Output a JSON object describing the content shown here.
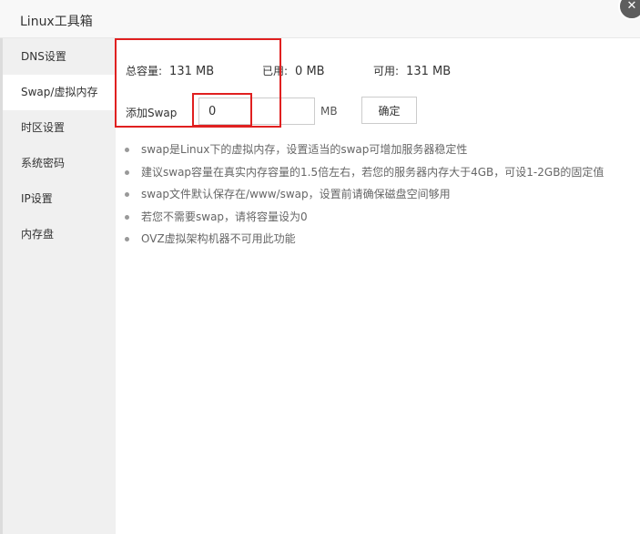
{
  "window": {
    "title": "Linux工具箱",
    "close_icon": "close-icon"
  },
  "sidebar": {
    "items": [
      {
        "label": "DNS设置",
        "active": false
      },
      {
        "label": "Swap/虚拟内存",
        "active": true
      },
      {
        "label": "时区设置",
        "active": false
      },
      {
        "label": "系统密码",
        "active": false
      },
      {
        "label": "IP设置",
        "active": false
      },
      {
        "label": "内存盘",
        "active": false
      }
    ]
  },
  "swap": {
    "total_label": "总容量:",
    "total_value": "131 MB",
    "used_label": "已用:",
    "used_value": "0 MB",
    "free_label": "可用:",
    "free_value": "131 MB",
    "add_label": "添加Swap",
    "input_value": "0",
    "unit": "MB",
    "confirm_label": "确定"
  },
  "notes": [
    "swap是Linux下的虚拟内存，设置适当的swap可增加服务器稳定性",
    "建议swap容量在真实内存容量的1.5倍左右，若您的服务器内存大于4GB，可设1-2GB的固定值",
    "swap文件默认保存在/www/swap，设置前请确保磁盘空间够用",
    "若您不需要swap，请将容量设为0",
    "OVZ虚拟架构机器不可用此功能"
  ],
  "colors": {
    "highlight": "#e02020",
    "sidebar_bg": "#f0f0f0",
    "active_item_bg": "#ffffff"
  }
}
